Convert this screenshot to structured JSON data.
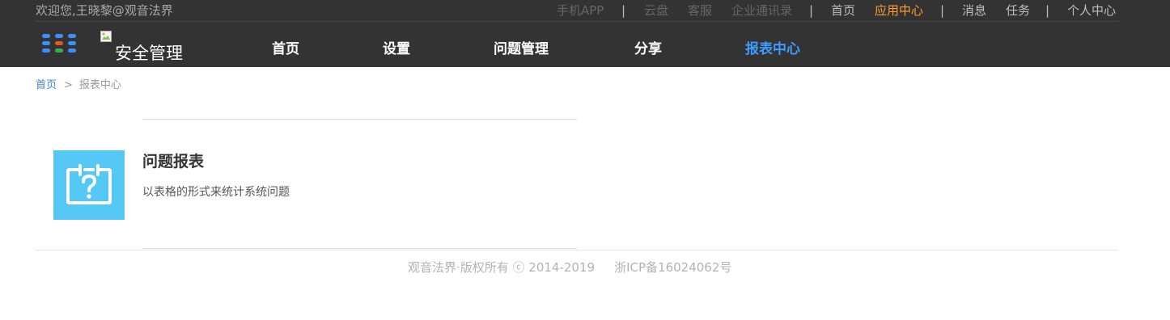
{
  "topbar": {
    "welcome": "欢迎您,王晓黎@观音法界",
    "links": {
      "mobile_app": "手机APP",
      "cloud_disk": "云盘",
      "customer_service": "客服",
      "enterprise_contacts": "企业通讯录",
      "home": "首页",
      "app_center": "应用中心",
      "messages": "消息",
      "tasks": "任务",
      "personal_center": "个人中心"
    },
    "separator": "|",
    "colors": {
      "background": "#333333",
      "active": "#ff9d2e"
    }
  },
  "header": {
    "apps_icon": "grid-dots-icon",
    "brand_alt": "安全管理",
    "nav": [
      {
        "label": "首页",
        "active": false
      },
      {
        "label": "设置",
        "active": false
      },
      {
        "label": "问题管理",
        "active": false
      },
      {
        "label": "分享",
        "active": false
      },
      {
        "label": "报表中心",
        "active": true
      }
    ],
    "colors": {
      "nav_active": "#3f9bff"
    }
  },
  "breadcrumb": {
    "home": "首页",
    "separator": ">",
    "current": "报表中心"
  },
  "report": {
    "icon": "calendar-question-icon",
    "icon_color": "#55c8f6",
    "title": "问题报表",
    "description": "以表格的形式来统计系统问题"
  },
  "footer": {
    "copyright": "观音法界·版权所有 ⓒ 2014-2019",
    "icp": "浙ICP备16024062号"
  }
}
